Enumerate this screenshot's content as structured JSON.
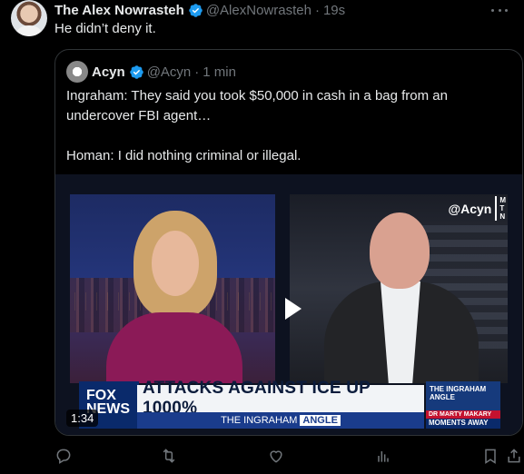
{
  "tweet": {
    "author_name": "The Alex Nowrasteh",
    "handle": "@AlexNowrasteh",
    "separator": "·",
    "time": "19s",
    "text": "He didn’t deny it."
  },
  "quoted": {
    "author_name": "Acyn",
    "handle": "@Acyn",
    "separator": "·",
    "time": "1 min",
    "lines": [
      "Ingraham: They said you took $50,000 in cash in a bag from an undercover FBI agent…",
      "",
      "Homan: I did nothing criminal or illegal."
    ]
  },
  "video": {
    "watermark": "@Acyn",
    "mtn": [
      "M",
      "T",
      "N"
    ],
    "logo_lines": [
      "FOX",
      "NEWS"
    ],
    "headline": "ATTACKS AGAINST ICE UP 1000%",
    "sub_prefix": "THE INGRAHAM",
    "sub_badge": "ANGLE",
    "promo_title": "THE INGRAHAM ANGLE",
    "promo_red": "DR MARTY MAKARY",
    "promo_blue": "MOMENTS AWAY",
    "duration": "1:34"
  },
  "colors": {
    "background": "#000000",
    "text": "#e7e9ea",
    "muted": "#71767b",
    "verified": "#1d9bf0",
    "border": "#2f3336"
  },
  "icons": [
    "verified-icon",
    "more-icon",
    "play-icon",
    "reply-icon",
    "retweet-icon",
    "like-icon",
    "views-icon",
    "bookmark-icon",
    "share-icon"
  ]
}
